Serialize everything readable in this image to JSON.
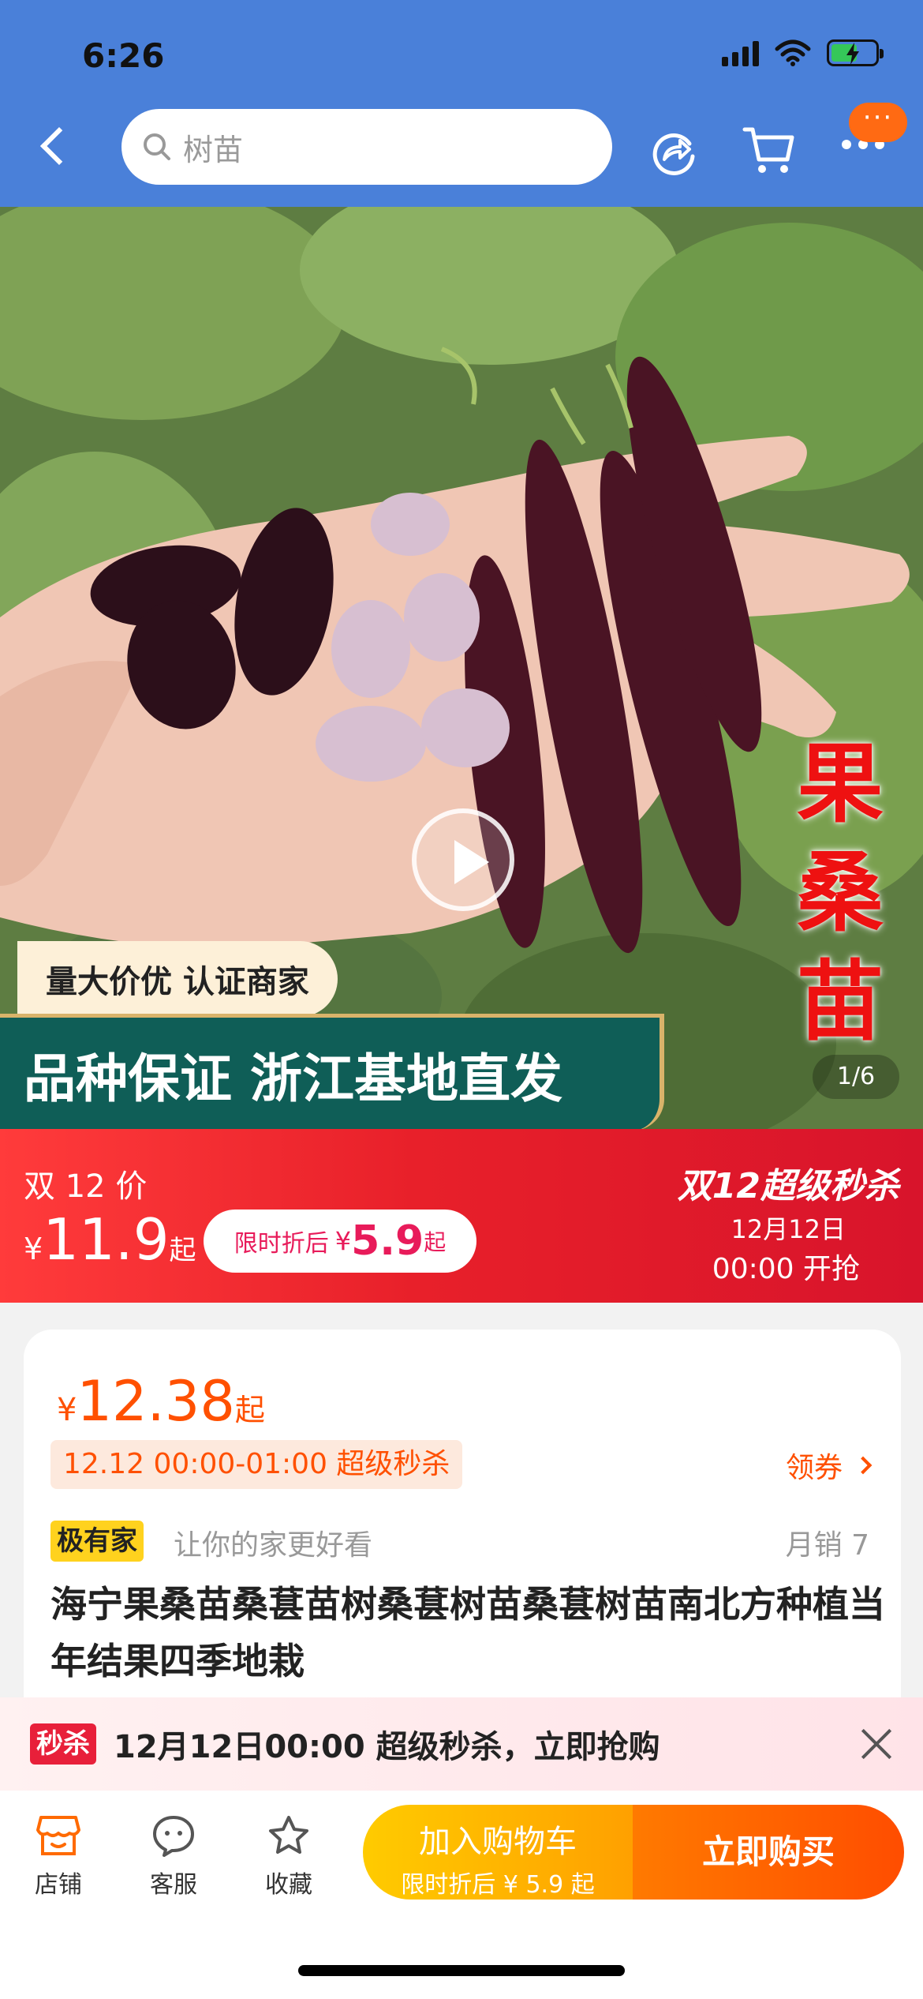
{
  "status": {
    "time": "6:26"
  },
  "header": {
    "search_text": "树苗",
    "more_badge": "···"
  },
  "hero": {
    "promo_small": "量大价优  认证商家",
    "promo_big": "品种保证  浙江基地直发",
    "vertical_text": [
      "果",
      "桑",
      "苗"
    ],
    "page_indicator": "1/6"
  },
  "sale_banner": {
    "label": "双 12 价",
    "currency": "¥",
    "price": "11.9",
    "price_suffix": "起",
    "pill_text": "限时折后",
    "pill_currency": "¥",
    "pill_price": "5.9",
    "pill_suffix": "起",
    "title": "双12超级秒杀",
    "date": "12月12日",
    "time": "00:00 开抢"
  },
  "product": {
    "currency": "¥",
    "price": "12.38",
    "price_suffix": "起",
    "deal_tag": "12.12 00:00-01:00 超级秒杀",
    "coupon": "领券",
    "brand": "极有家",
    "slogan": "让你的家更好看",
    "monthly_sales": "月销  7",
    "title": "海宁果桑苗桑葚苗树桑葚树苗桑葚树苗南北方种植当年结果四季地栽"
  },
  "notice": {
    "tag": "秒杀",
    "message": "12月12日00:00 超级秒杀，立即抢购"
  },
  "bottom_bar": {
    "shop": "店铺",
    "service": "客服",
    "favorite": "收藏",
    "add_to_cart": "加入购物车",
    "add_to_cart_sub": "限时折后 ¥ 5.9 起",
    "buy_now": "立即购买"
  },
  "colors": {
    "header_blue": "#4a80d9",
    "accent_orange": "#ff5000",
    "sale_red": "#e8202a",
    "cart_yellow": "#ffcb00",
    "brand_yellow": "#ffd21e"
  }
}
